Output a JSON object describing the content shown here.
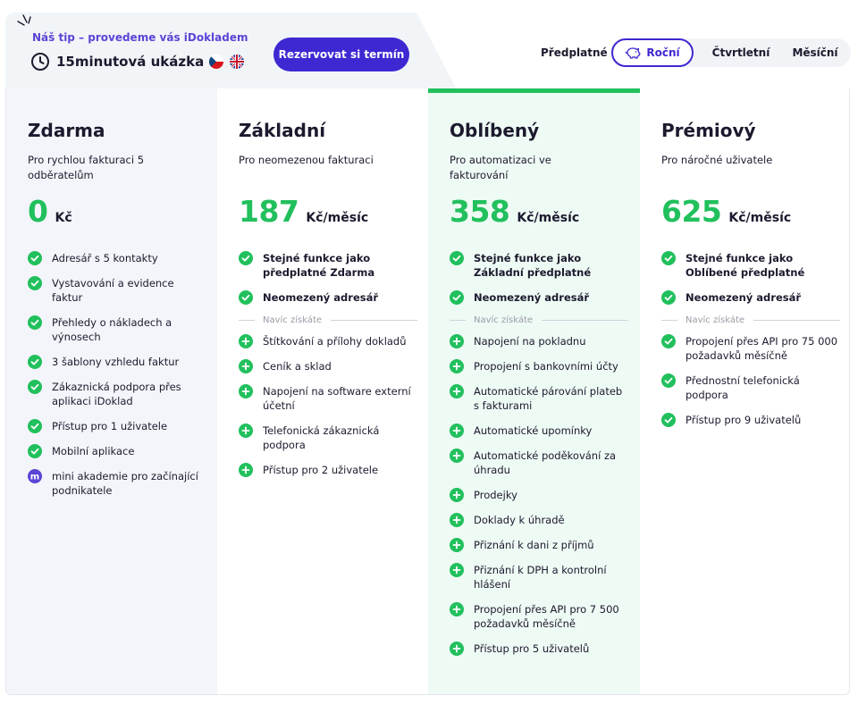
{
  "banner": {
    "tip": "Náš tip – provedeme vás iDokladem",
    "title": "15minutová ukázka",
    "book_button": "Rezervovat si termín"
  },
  "billing": {
    "label": "Předplatné",
    "options": [
      "Roční",
      "Čtvrtletní",
      "Měsíční"
    ],
    "selected": "Roční"
  },
  "colors": {
    "accent": "#3e28d2",
    "green": "#21c05d",
    "badge": "#5a45d6"
  },
  "plans": [
    {
      "name": "Zdarma",
      "desc": "Pro rychlou fakturaci 5 odběratelům",
      "price": "0",
      "unit": "Kč",
      "features": [
        "Adresář s 5 kontakty",
        "Vystavování a evidence faktur",
        "Přehledy o nákladech a výnosech",
        "3 šablony vzhledu faktur",
        "Zákaznická podpora přes aplikaci iDoklad",
        "Přístup pro 1 uživatele",
        "Mobilní aplikace",
        "mini akademie pro začínající podnikatele"
      ],
      "badge_letter": "m"
    },
    {
      "name": "Základní",
      "desc": "Pro neomezenou fakturaci",
      "price": "187",
      "unit": "Kč/měsíc",
      "base_features": [
        "Stejné funkce jako předplatné Zdarma",
        "Neomezený adresář"
      ],
      "extra_label": "Navíc získáte",
      "extra_features": [
        "Štítkování a přílohy dokladů",
        "Ceník a sklad",
        "Napojení na software externí účetní",
        "Telefonická zákaznická podpora",
        "Přístup pro 2 uživatele"
      ]
    },
    {
      "name": "Oblíbený",
      "desc": "Pro automatizaci ve fakturování",
      "price": "358",
      "unit": "Kč/měsíc",
      "base_features": [
        "Stejné funkce jako Základní předplatné",
        "Neomezený adresář"
      ],
      "extra_label": "Navíc získáte",
      "extra_features": [
        "Napojení na pokladnu",
        "Propojení s bankovními účty",
        "Automatické párování plateb s fakturami",
        "Automatické upomínky",
        "Automatické poděkování za úhradu",
        "Prodejky",
        "Doklady k úhradě",
        "Přiznání k dani z příjmů",
        "Přiznání k DPH a kontrolní hlášení",
        "Propojení přes API pro 7 500 požadavků měsíčně",
        "Přístup pro 5 uživatelů"
      ]
    },
    {
      "name": "Prémiový",
      "desc": "Pro náročné uživatele",
      "price": "625",
      "unit": "Kč/měsíc",
      "base_features": [
        "Stejné funkce jako Oblíbené předplatné",
        "Neomezený adresář"
      ],
      "extra_label": "Navíc získáte",
      "extra_features": [
        "Propojení přes API pro 75 000 požadavků měsíčně",
        "Přednostní telefonická podpora",
        "Přístup pro 9 uživatelů"
      ]
    }
  ]
}
